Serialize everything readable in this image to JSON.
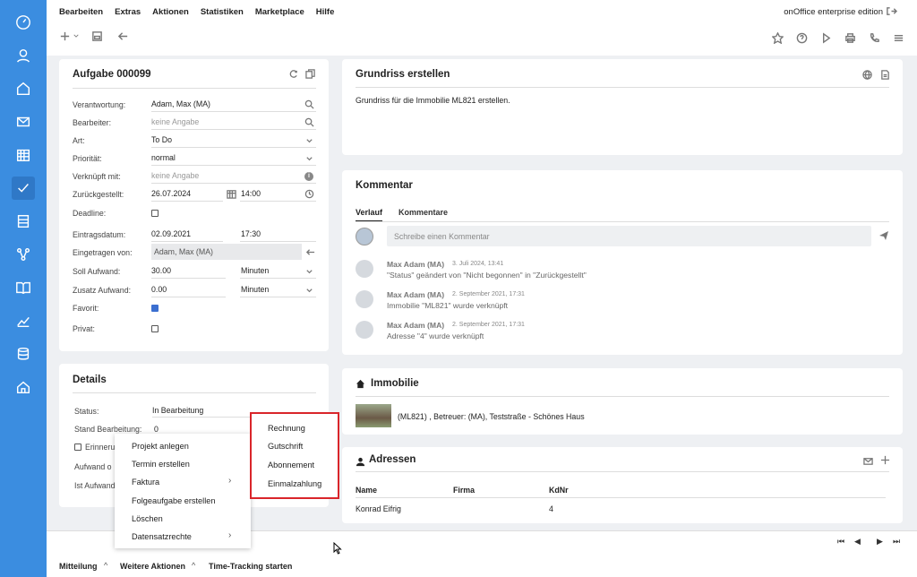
{
  "menu": [
    "Bearbeiten",
    "Extras",
    "Aktionen",
    "Statistiken",
    "Marketplace",
    "Hilfe"
  ],
  "edition": "onOffice enterprise edition",
  "task": {
    "title": "Aufgabe 000099",
    "fields": {
      "verantwortung_label": "Verantwortung:",
      "verantwortung": "Adam, Max (MA)",
      "bearbeiter_label": "Bearbeiter:",
      "bearbeiter": "keine Angabe",
      "art_label": "Art:",
      "art": "To Do",
      "prioritaet_label": "Priorität:",
      "prioritaet": "normal",
      "verknuepft_label": "Verknüpft mit:",
      "verknuepft": "keine Angabe",
      "zurueck_label": "Zurückgestellt:",
      "zurueck_date": "26.07.2024",
      "zurueck_time": "14:00",
      "deadline_label": "Deadline:",
      "eintrag_label": "Eintragsdatum:",
      "eintrag_date": "02.09.2021",
      "eintrag_time": "17:30",
      "eingetragen_label": "Eingetragen von:",
      "eingetragen": "Adam, Max (MA)",
      "soll_label": "Soll Aufwand:",
      "soll": "30.00",
      "soll_unit": "Minuten",
      "zusatz_label": "Zusatz Aufwand:",
      "zusatz": "0.00",
      "zusatz_unit": "Minuten",
      "favorit_label": "Favorit:",
      "privat_label": "Privat:"
    }
  },
  "details": {
    "title": "Details",
    "status_label": "Status:",
    "status": "In Bearbeitung",
    "stand_label": "Stand Bearbeitung:",
    "stand": "0",
    "erinnerung_label": "Erinneru",
    "aufwand_label": "Aufwand o",
    "ist_label": "Ist Aufwand"
  },
  "context_menu": [
    "Projekt anlegen",
    "Termin erstellen",
    "Faktura",
    "Folgeaufgabe erstellen",
    "Löschen",
    "Datensatzrechte"
  ],
  "submenu": [
    "Rechnung",
    "Gutschrift",
    "Abonnement",
    "Einmalzahlung"
  ],
  "grundriss": {
    "title": "Grundriss erstellen",
    "text": "Grundriss für die Immobilie ML821 erstellen."
  },
  "kommentar": {
    "title": "Kommentar",
    "tabs": [
      "Verlauf",
      "Kommentare"
    ],
    "placeholder": "Schreibe einen Kommentar",
    "entries": [
      {
        "author": "Max Adam (MA)",
        "date": "3. Juli 2024, 13:41",
        "text": "\"Status\" geändert von \"Nicht begonnen\" in \"Zurückgestellt\""
      },
      {
        "author": "Max Adam (MA)",
        "date": "2. September 2021, 17:31",
        "text": "Immobilie \"ML821\" wurde verknüpft"
      },
      {
        "author": "Max Adam (MA)",
        "date": "2. September 2021, 17:31",
        "text": "Adresse \"4\" wurde verknüpft"
      }
    ]
  },
  "immobilie": {
    "title": "Immobilie",
    "text": "(ML821) , Betreuer: (MA), Teststraße - Schönes Haus"
  },
  "adressen": {
    "title": "Adressen",
    "headers": [
      "Name",
      "Firma",
      "KdNr"
    ],
    "rows": [
      {
        "name": "Konrad Eifrig",
        "firma": "",
        "kdnr": "4"
      }
    ]
  },
  "bottom": {
    "mitteilung": "Mitteilung",
    "weitere": "Weitere Aktionen",
    "tracking": "Time-Tracking starten"
  }
}
